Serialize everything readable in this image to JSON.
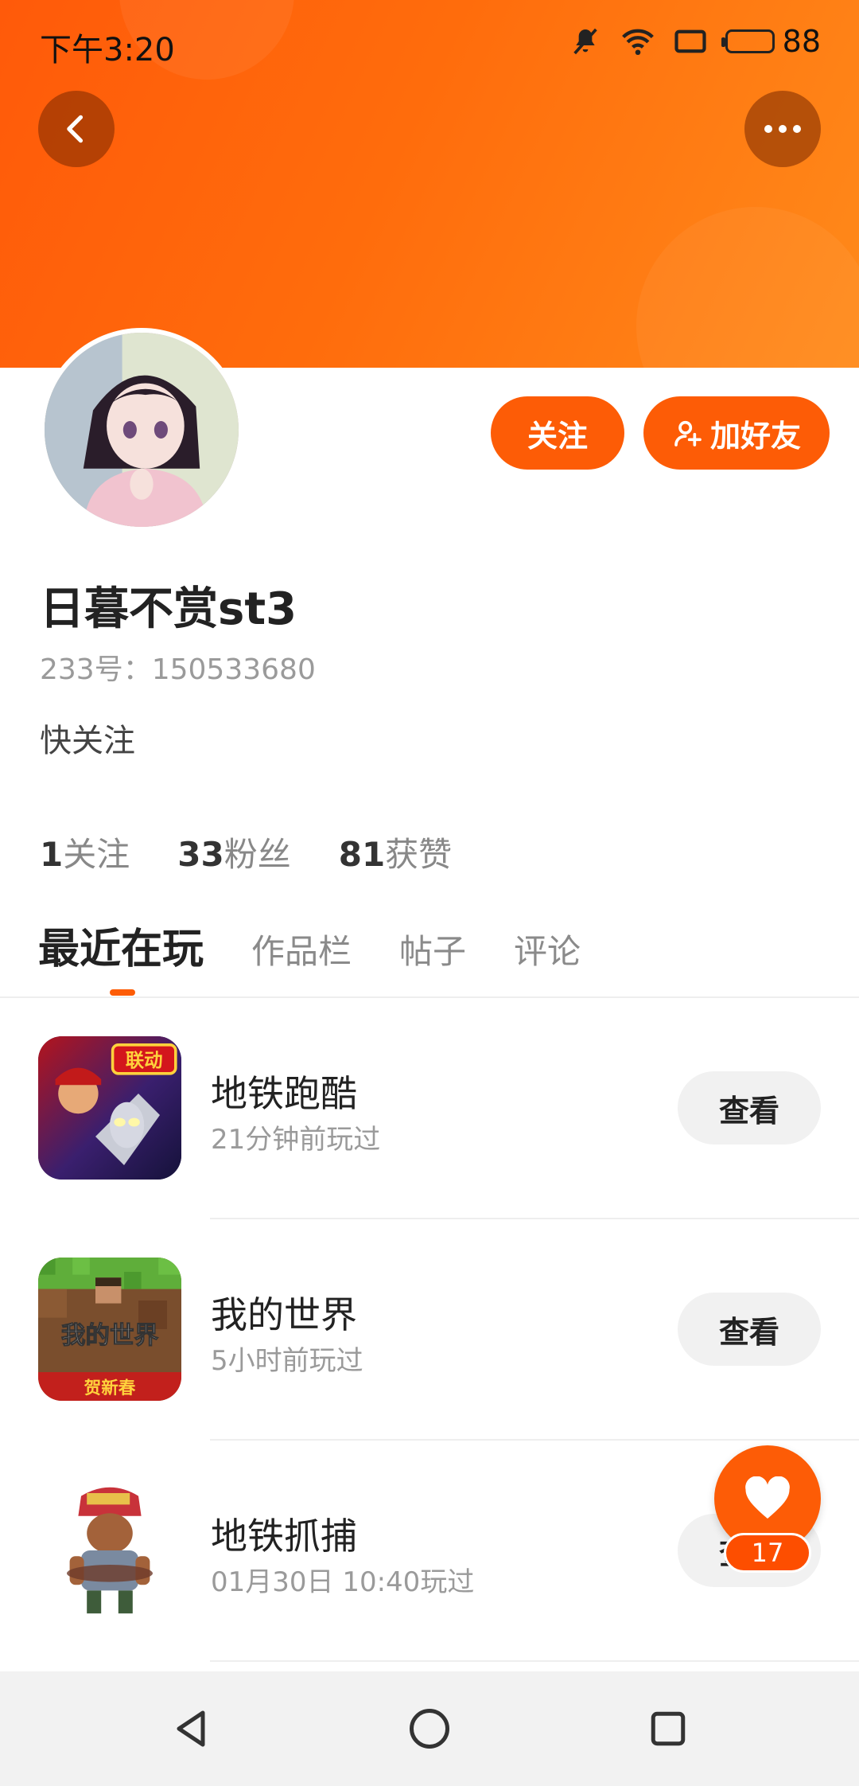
{
  "status_bar": {
    "time": "下午3:20",
    "battery_level": "88",
    "icons": [
      "mute-icon",
      "wifi-icon",
      "screen-icon",
      "battery-icon"
    ]
  },
  "header": {
    "back_icon": "chevron-left-icon",
    "more_icon": "more-dots-icon",
    "gradient_colors": [
      "#ff5a0a",
      "#ff8a1a"
    ]
  },
  "profile": {
    "username": "日暮不赏st3",
    "user_id": "233号：150533680",
    "bio": "快关注",
    "follow_label": "关注",
    "add_friend_label": "加好友"
  },
  "stats": [
    {
      "count": "1",
      "label": "关注"
    },
    {
      "count": "33",
      "label": "粉丝"
    },
    {
      "count": "81",
      "label": "获赞"
    }
  ],
  "tabs": [
    {
      "label": "最近在玩",
      "active": true
    },
    {
      "label": "作品栏",
      "active": false
    },
    {
      "label": "帖子",
      "active": false
    },
    {
      "label": "评论",
      "active": false
    }
  ],
  "games": [
    {
      "name": "地铁跑酷",
      "played": "21分钟前玩过",
      "action": "查看",
      "icon_text": "联动"
    },
    {
      "name": "我的世界",
      "played": "5小时前玩过",
      "action": "查看",
      "icon_text": "我的世界",
      "icon_subtext": "贺新春"
    },
    {
      "name": "地铁抓捕",
      "played": "01月30日 10:40玩过",
      "action": "查看"
    }
  ],
  "fab": {
    "icon": "heart-icon",
    "count": "17"
  },
  "colors": {
    "accent": "#fd5c06",
    "button_gray": "#f1f1f1",
    "muted_text": "#9a9a9a"
  }
}
